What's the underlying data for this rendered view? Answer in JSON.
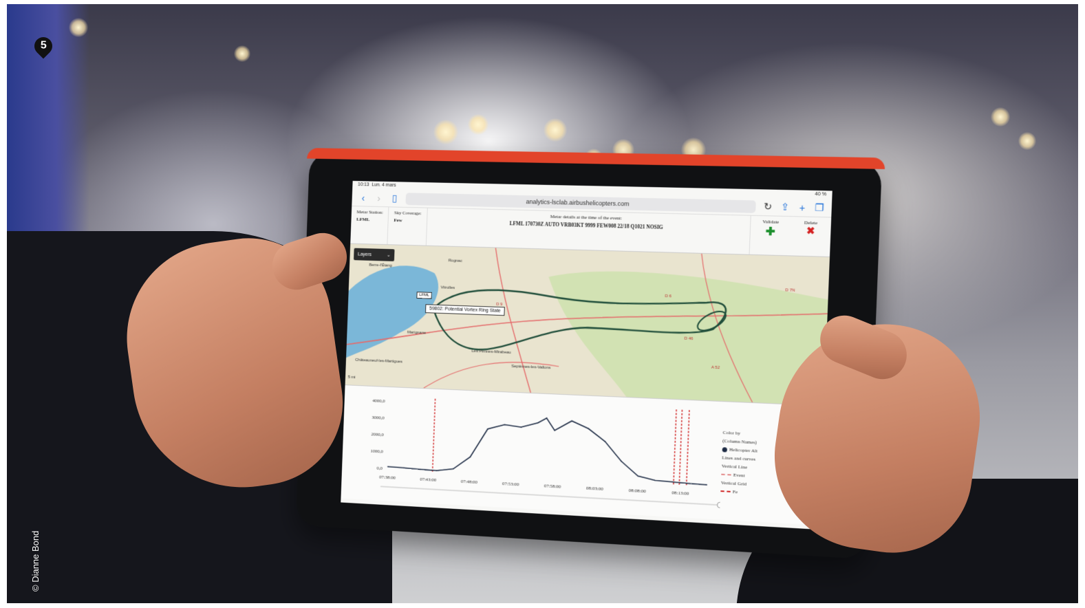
{
  "badge": {
    "number": "5"
  },
  "credit": "© Dianne Bond",
  "tablet": {
    "status": {
      "time": "10:13",
      "date": "Lun. 4 mars",
      "battery": "40 %"
    },
    "browser": {
      "url": "analytics-lsclab.airbushelicopters.com"
    },
    "metar": {
      "station_label": "Metar Station:",
      "station_value": "LFML",
      "sky_label": "Sky Coverage:",
      "sky_value": "Few",
      "details_label": "Metar details at the time of the event:",
      "details_value": "LFML 170730Z AUTO VRB03KT 9999 FEW008 22/18 Q1021 NOSIG",
      "validate_label": "Validate",
      "delete_label": "Delete"
    },
    "map": {
      "layers_label": "Layers",
      "airport_tag": "LFML",
      "event_popup": "59802: Potential Vortex Ring State",
      "places": [
        "Berre-l'Étang",
        "Marignane",
        "Châteauneuf-les-Martigues",
        "Les Pennes-Mirabeau",
        "Septèmes-les-Vallons",
        "Rognac",
        "Vitrolles"
      ],
      "road_labels": [
        "D 9",
        "D 6",
        "D 7N",
        "A 52",
        "D 46"
      ],
      "scale": "5 mi"
    },
    "legend": {
      "color_by": "Color by",
      "column_names": "(Column Names)",
      "series": "Helicopter Alt",
      "lines_curves": "Lines and curves",
      "vertical_line": "Vertical Line",
      "event": "Event",
      "vertical_grid": "Vertical Grid",
      "fe": "Fe"
    }
  },
  "chart_data": {
    "type": "line",
    "series": [
      {
        "name": "Helicopter Alt",
        "x": [
          "07:38:00",
          "07:40:00",
          "07:42:00",
          "07:44:00",
          "07:46:00",
          "07:48:00",
          "07:50:00",
          "07:52:00",
          "07:54:00",
          "07:56:00",
          "07:57:00",
          "07:58:00",
          "08:00:00",
          "08:02:00",
          "08:04:00",
          "08:06:00",
          "08:08:00",
          "08:10:00",
          "08:12:00",
          "08:14:00",
          "08:16:00"
        ],
        "values": [
          80,
          60,
          20,
          0,
          150,
          900,
          2600,
          2900,
          2800,
          3100,
          3400,
          2700,
          3300,
          2900,
          2200,
          1100,
          300,
          100,
          60,
          20,
          0
        ]
      }
    ],
    "event_lines_x": [
      "07:43:30",
      "08:12:10",
      "08:12:50",
      "08:13:40"
    ],
    "ylim": [
      0,
      4000
    ],
    "yticks": [
      "4000,0",
      "3000,0",
      "2000,0",
      "1000,0",
      "0,0"
    ],
    "xticks": [
      "07:38:00",
      "07:43:00",
      "07:48:00",
      "07:53:00",
      "07:58:00",
      "08:03:00",
      "08:08:00",
      "08:13:00"
    ],
    "grid": false
  },
  "colors": {
    "accent": "#e2442a",
    "line": "#1d2b44",
    "event": "#d12a2a",
    "track": "#1f4d3a"
  }
}
